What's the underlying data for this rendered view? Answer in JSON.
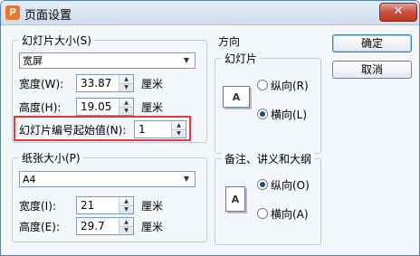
{
  "window": {
    "title": "页面设置",
    "app_icon": "P",
    "close": "✕"
  },
  "slide_size": {
    "legend": "幻灯片大小(S)",
    "selected": "宽屏",
    "width_label": "宽度(W):",
    "width_value": "33.87",
    "height_label": "高度(H):",
    "height_value": "19.05",
    "unit": "厘米",
    "start_number_label": "幻灯片编号起始值(N):",
    "start_number_value": "1"
  },
  "paper_size": {
    "legend": "纸张大小(P)",
    "selected": "A4",
    "width_label": "宽度(I):",
    "width_value": "21",
    "height_label": "高度(E):",
    "height_value": "29.7",
    "unit": "厘米"
  },
  "orientation": {
    "title": "方向",
    "slides": {
      "legend": "幻灯片",
      "portrait_label": "纵向(R)",
      "landscape_label": "横向(L)",
      "selected": "landscape",
      "icon_letter": "A"
    },
    "notes": {
      "legend": "备注、讲义和大纲",
      "portrait_label": "纵向(O)",
      "landscape_label": "横向(A)",
      "selected": "portrait",
      "icon_letter": "A"
    }
  },
  "buttons": {
    "ok": "确定",
    "cancel": "取消"
  },
  "colors": {
    "highlight": "#e23a3a",
    "accent": "#f27425"
  }
}
